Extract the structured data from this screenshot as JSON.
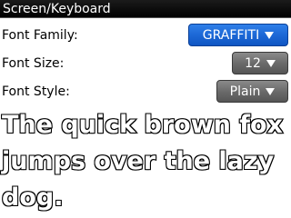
{
  "window": {
    "title": "Screen/Keyboard"
  },
  "settings": {
    "font_family": {
      "label": "Font Family:",
      "value": "GRAFFITI"
    },
    "font_size": {
      "label": "Font Size:",
      "value": "12"
    },
    "font_style": {
      "label": "Font Style:",
      "value": "Plain"
    }
  },
  "preview": {
    "text": "The quick brown fox jumps over the lazy dog."
  },
  "colors": {
    "title_bar": "#000000",
    "focused_dropdown": "#1d68d6",
    "normal_dropdown": "#6b6b6b"
  }
}
